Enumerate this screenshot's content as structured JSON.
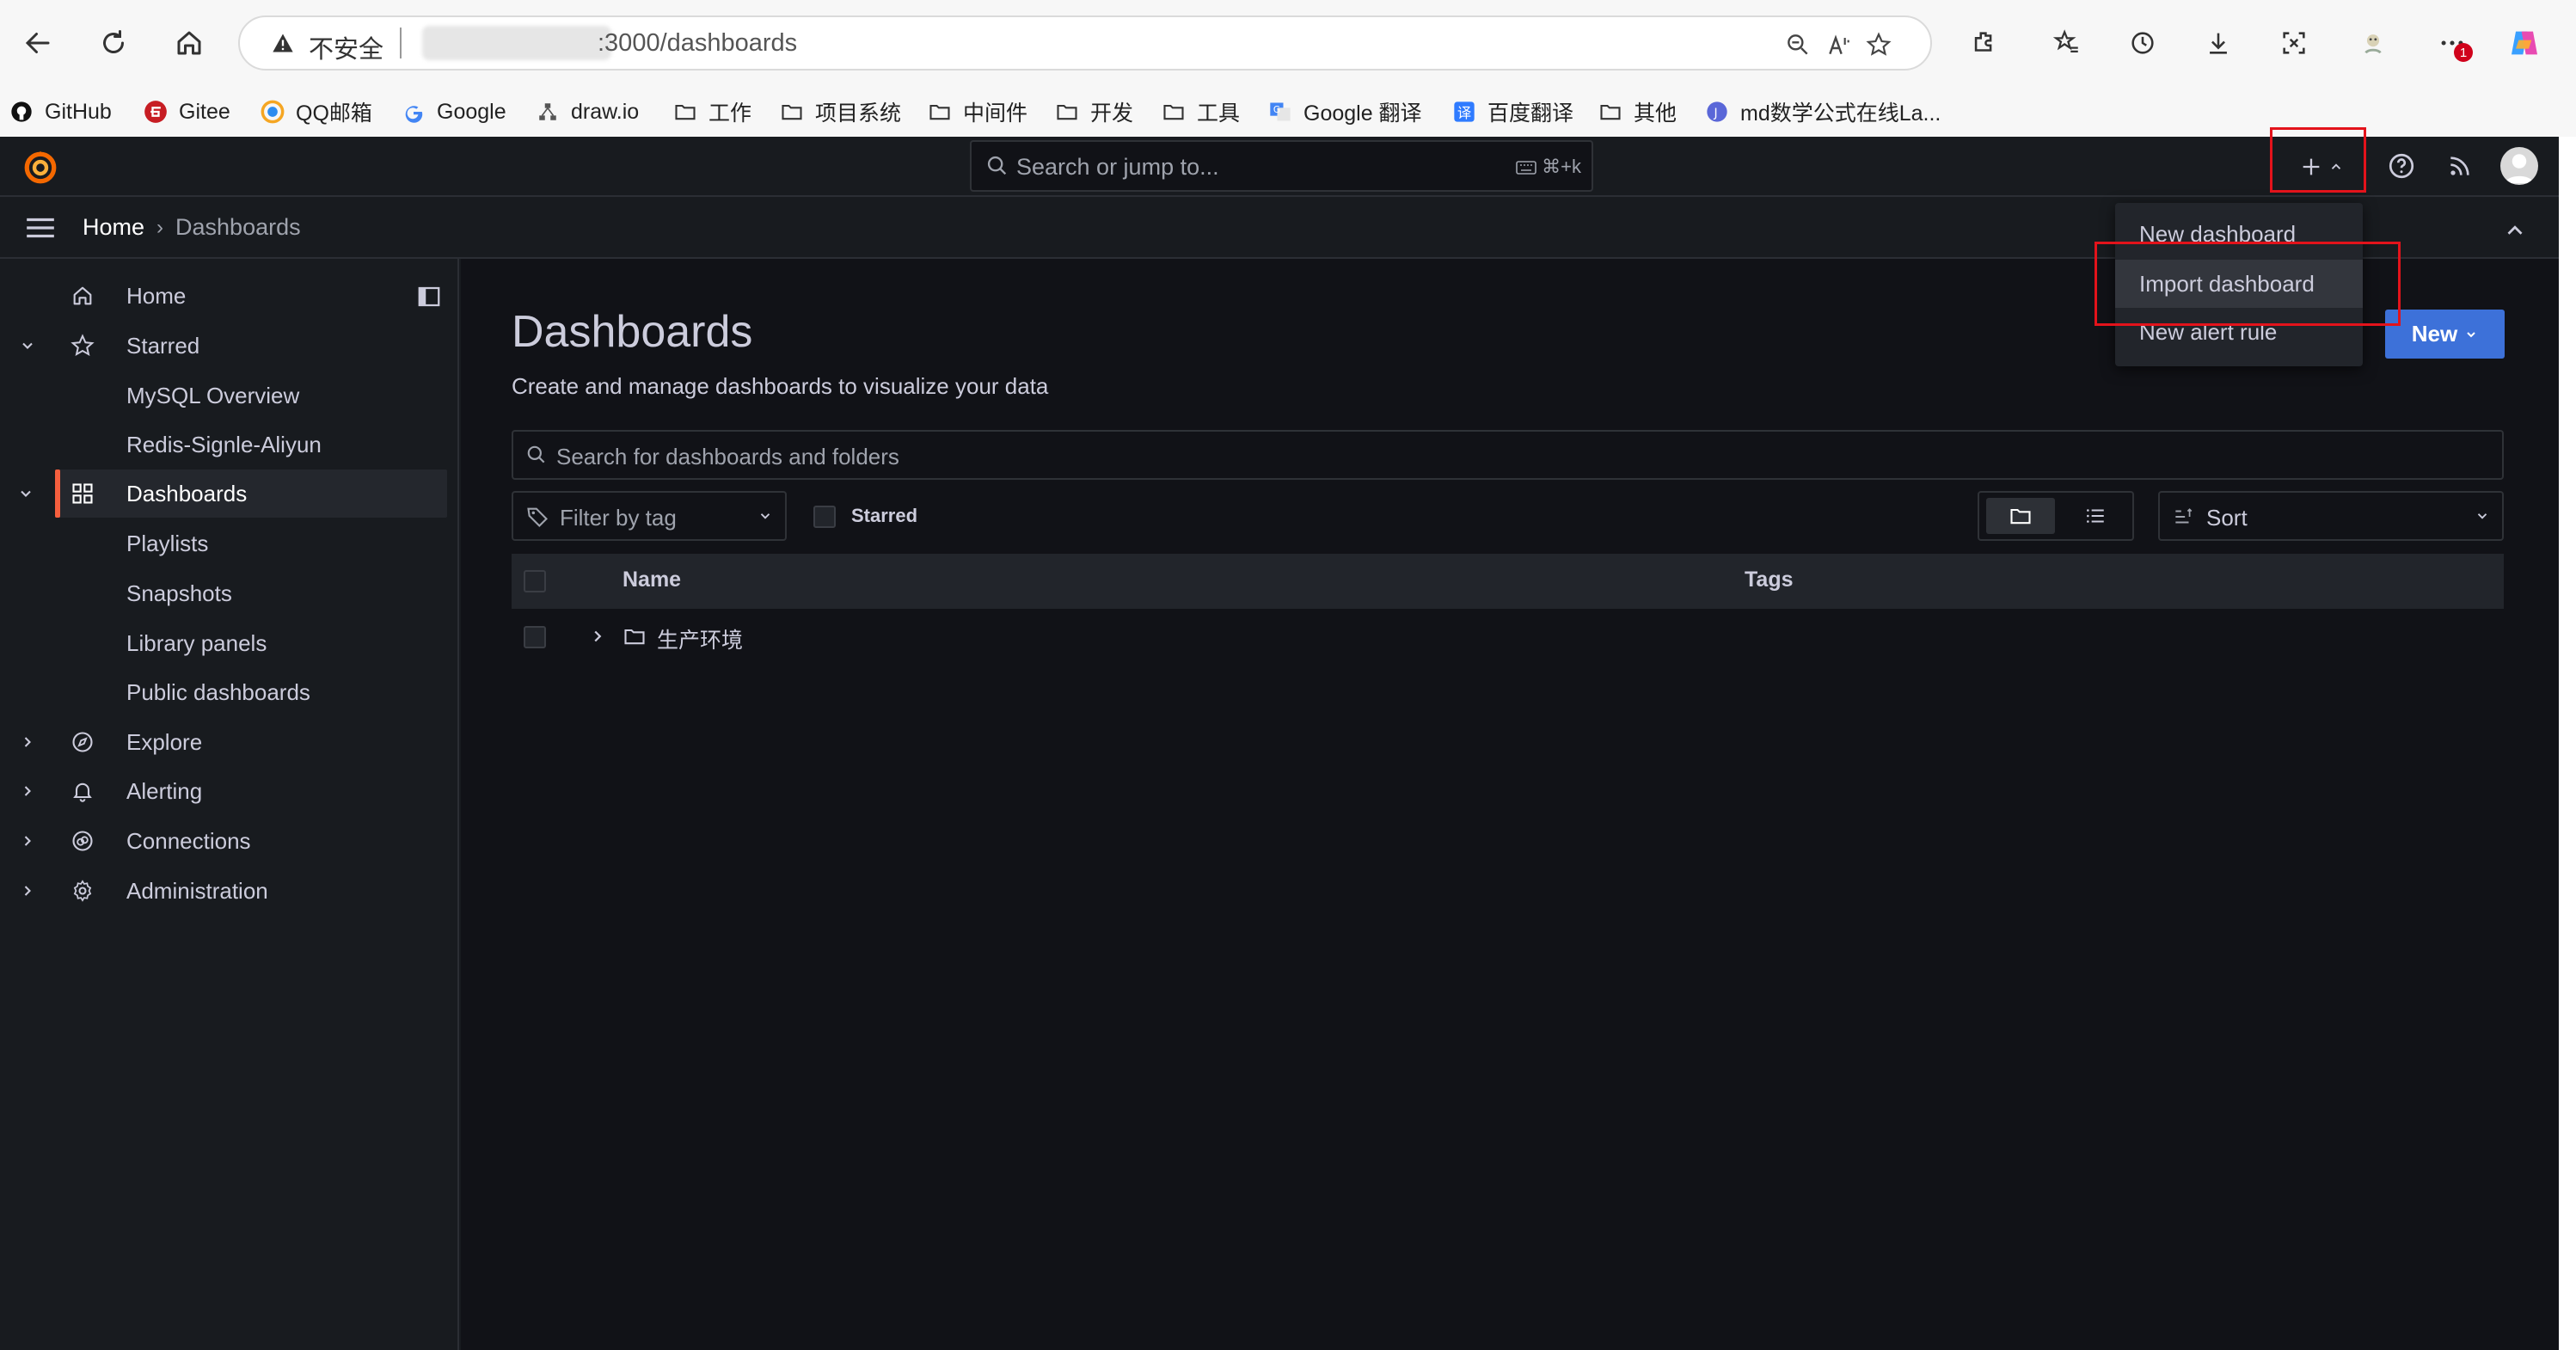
{
  "browser": {
    "security_label": "不安全",
    "url": ":3000/dashboards",
    "bookmarks": [
      {
        "label": "GitHub",
        "icon": "github-icon"
      },
      {
        "label": "Gitee",
        "icon": "gitee-icon"
      },
      {
        "label": "QQ邮箱",
        "icon": "qq-mail-icon"
      },
      {
        "label": "Google",
        "icon": "google-icon"
      },
      {
        "label": "draw.io",
        "icon": "drawio-icon"
      },
      {
        "label": "工作",
        "icon": "folder-icon"
      },
      {
        "label": "项目系统",
        "icon": "folder-icon"
      },
      {
        "label": "中间件",
        "icon": "folder-icon"
      },
      {
        "label": "开发",
        "icon": "folder-icon"
      },
      {
        "label": "工具",
        "icon": "folder-icon"
      },
      {
        "label": "Google 翻译",
        "icon": "google-translate-icon"
      },
      {
        "label": "百度翻译",
        "icon": "baidu-translate-icon"
      },
      {
        "label": "其他",
        "icon": "folder-icon"
      },
      {
        "label": "md数学公式在线La...",
        "icon": "md-math-icon"
      }
    ],
    "notification_badge": "1"
  },
  "topbar": {
    "search_placeholder": "Search or jump to...",
    "search_shortcut": "⌘+k"
  },
  "breadcrumb": {
    "home": "Home",
    "separator": "›",
    "current": "Dashboards"
  },
  "sidebar": {
    "items": [
      {
        "label": "Home",
        "icon": "home-icon"
      },
      {
        "label": "Starred",
        "icon": "star-icon"
      },
      {
        "label": "MySQL Overview"
      },
      {
        "label": "Redis-Signle-Aliyun"
      },
      {
        "label": "Dashboards",
        "icon": "apps-icon"
      },
      {
        "label": "Playlists"
      },
      {
        "label": "Snapshots"
      },
      {
        "label": "Library panels"
      },
      {
        "label": "Public dashboards"
      },
      {
        "label": "Explore",
        "icon": "compass-icon"
      },
      {
        "label": "Alerting",
        "icon": "bell-icon"
      },
      {
        "label": "Connections",
        "icon": "connections-icon"
      },
      {
        "label": "Administration",
        "icon": "cog-icon"
      }
    ]
  },
  "main": {
    "title": "Dashboards",
    "subtitle": "Create and manage dashboards to visualize your data",
    "search_placeholder": "Search for dashboards and folders",
    "filter_tag_placeholder": "Filter by tag",
    "starred_label": "Starred",
    "sort_placeholder": "Sort",
    "new_button": "New",
    "table": {
      "columns": [
        "Name",
        "Tags"
      ],
      "rows": [
        {
          "name": "生产环境",
          "type": "folder"
        }
      ]
    }
  },
  "add_menu": {
    "items": [
      "New dashboard",
      "Import dashboard",
      "New alert rule"
    ]
  },
  "colors": {
    "grafana_bg": "#181b1f",
    "main_bg": "#111217",
    "accent_orange": "#f55f3e",
    "primary_blue": "#3d71d9",
    "highlight_red": "#e3131b"
  }
}
